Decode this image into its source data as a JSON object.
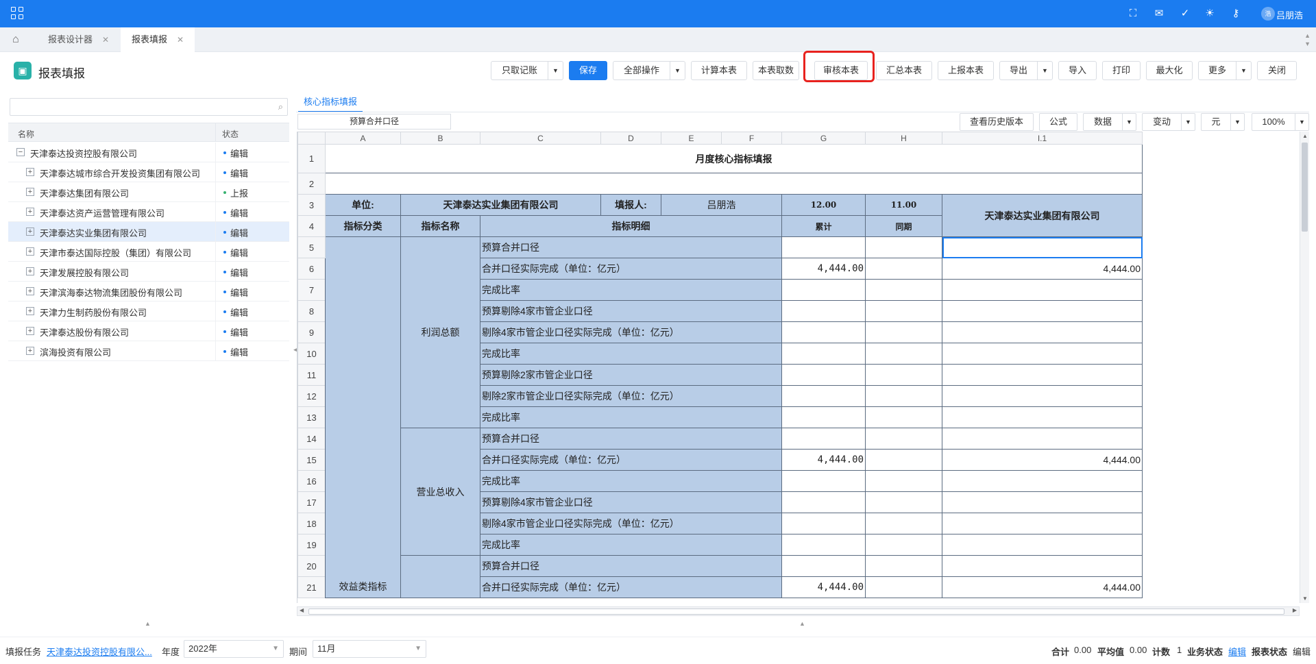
{
  "topbar": {
    "username": "吕朋浩",
    "avatar_text": "浩",
    "icons": [
      "fullscreen-icon",
      "mail-icon",
      "check-circle-icon",
      "bulb-icon",
      "key-icon"
    ]
  },
  "tabs": [
    {
      "label": "报表设计器",
      "active": false
    },
    {
      "label": "报表填报",
      "active": true
    }
  ],
  "page": {
    "title": "报表填报"
  },
  "toolbar": {
    "readonly_label": "只取记账",
    "save_label": "保存",
    "all_ops_label": "全部操作",
    "calc_label": "计算本表",
    "fetch_label": "本表取数",
    "audit_label": "审核本表",
    "summary_label": "汇总本表",
    "submit_label": "上报本表",
    "export_label": "导出",
    "import_label": "导入",
    "print_label": "打印",
    "maximize_label": "最大化",
    "more_label": "更多",
    "close_label": "关闭"
  },
  "tree": {
    "col_name": "名称",
    "col_status": "状态",
    "rows": [
      {
        "label": "天津泰达投资控股有限公司",
        "status": "编辑",
        "level": 0,
        "toggle": "−"
      },
      {
        "label": "天津泰达城市综合开发投资集团有限公司",
        "status": "编辑",
        "level": 1,
        "toggle": "+"
      },
      {
        "label": "天津泰达集团有限公司",
        "status": "上报",
        "level": 1,
        "toggle": "+"
      },
      {
        "label": "天津泰达资产运营管理有限公司",
        "status": "编辑",
        "level": 1,
        "toggle": "+"
      },
      {
        "label": "天津泰达实业集团有限公司",
        "status": "编辑",
        "level": 1,
        "toggle": "+"
      },
      {
        "label": "天津市泰达国际控股（集团）有限公司",
        "status": "编辑",
        "level": 1,
        "toggle": "+"
      },
      {
        "label": "天津发展控股有限公司",
        "status": "编辑",
        "level": 1,
        "toggle": "+"
      },
      {
        "label": "天津滨海泰达物流集团股份有限公司",
        "status": "编辑",
        "level": 1,
        "toggle": "+"
      },
      {
        "label": "天津力生制药股份有限公司",
        "status": "编辑",
        "level": 1,
        "toggle": "+"
      },
      {
        "label": "天津泰达股份有限公司",
        "status": "编辑",
        "level": 1,
        "toggle": "+"
      },
      {
        "label": "滨海投资有限公司",
        "status": "编辑",
        "level": 1,
        "toggle": "+"
      }
    ]
  },
  "sheet": {
    "tab_label": "核心指标填报",
    "namebox_value": "预算合并口径",
    "history_label": "查看历史版本",
    "formula_label": "公式",
    "data_label": "数据",
    "change_label": "变动",
    "unit_label": "元",
    "zoom_label": "100%",
    "columns": [
      "A",
      "B",
      "C",
      "D",
      "E",
      "F",
      "G",
      "H",
      "I.1"
    ],
    "row_numbers": [
      "1",
      "2",
      "3",
      "4",
      "5",
      "6",
      "7",
      "8",
      "9",
      "10",
      "11",
      "12",
      "13",
      "14",
      "15",
      "16",
      "17",
      "18",
      "19",
      "20",
      "21"
    ],
    "title": "月度核心指标填报",
    "unit_key": "单位:",
    "unit_value": "天津泰达实业集团有限公司",
    "filler_key": "填报人:",
    "filler_value": "吕朋浩",
    "month_cur": "12.00",
    "month_prev": "11.00",
    "company_header": "天津泰达实业集团有限公司",
    "h_category": "指标分类",
    "h_name": "指标名称",
    "h_detail": "指标明细",
    "h_cumulative": "累计",
    "h_same": "同期",
    "category": "效益类指标",
    "group1": "利润总额",
    "group2": "营业总收入",
    "details": [
      {
        "text": "预算合并口径",
        "g": "",
        "i": ""
      },
      {
        "text": "合并口径实际完成（单位：亿元）",
        "g": "4,444.00",
        "i": "4,444.00"
      },
      {
        "text": "完成比率",
        "g": "",
        "i": ""
      },
      {
        "text": "预算剔除4家市管企业口径",
        "g": "",
        "i": ""
      },
      {
        "text": "剔除4家市管企业口径实际完成（单位：亿元）",
        "g": "",
        "i": ""
      },
      {
        "text": "完成比率",
        "g": "",
        "i": ""
      },
      {
        "text": "预算剔除2家市管企业口径",
        "g": "",
        "i": ""
      },
      {
        "text": "剔除2家市管企业口径实际完成（单位：亿元）",
        "g": "",
        "i": ""
      },
      {
        "text": "完成比率",
        "g": "",
        "i": ""
      },
      {
        "text": "预算合并口径",
        "g": "",
        "i": ""
      },
      {
        "text": "合并口径实际完成（单位：亿元）",
        "g": "4,444.00",
        "i": "4,444.00"
      },
      {
        "text": "完成比率",
        "g": "",
        "i": ""
      },
      {
        "text": "预算剔除4家市管企业口径",
        "g": "",
        "i": ""
      },
      {
        "text": "剔除4家市管企业口径实际完成（单位：亿元）",
        "g": "",
        "i": ""
      },
      {
        "text": "完成比率",
        "g": "",
        "i": ""
      },
      {
        "text": "预算合并口径",
        "g": "",
        "i": ""
      },
      {
        "text": "合并口径实际完成（单位：亿元）",
        "g": "4,444.00",
        "i": "4,444.00"
      }
    ]
  },
  "status": {
    "task_label": "填报任务",
    "task_value": "天津泰达投资控股有限公...",
    "year_label": "年度",
    "year_value": "2022年",
    "period_label": "期间",
    "period_value": "11月",
    "sum_label": "合计",
    "sum_value": "0.00",
    "avg_label": "平均值",
    "avg_value": "0.00",
    "count_label": "计数",
    "count_value": "1",
    "biz_label": "业务状态",
    "biz_value": "编辑",
    "report_label": "报表状态",
    "report_value": "编辑"
  },
  "colors": {
    "brand": "#1b7cf0",
    "cell_blue": "#b8cde7",
    "highlight": "#e8221e"
  }
}
